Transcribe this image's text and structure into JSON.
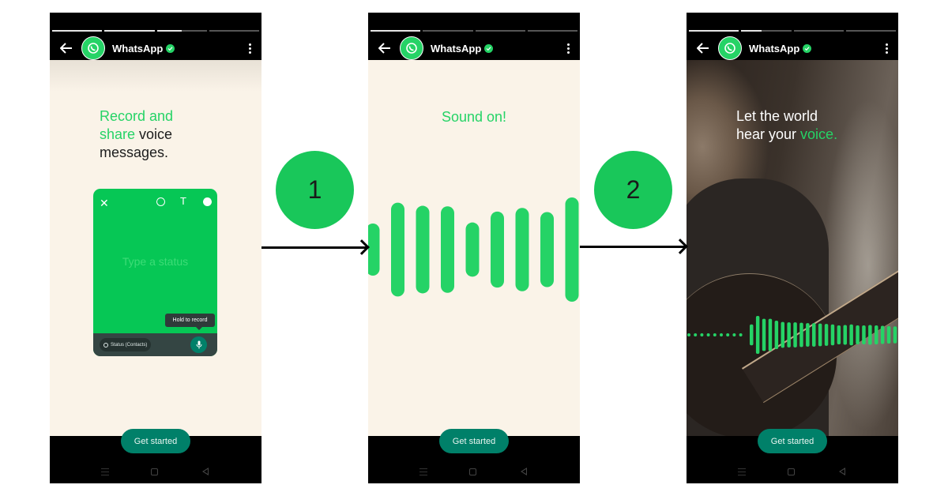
{
  "colors": {
    "brand_green": "#25d366",
    "teal_button": "#008069",
    "status_card_green": "#06c755",
    "cream_background": "#faf3e8",
    "step_badge": "#19c75a"
  },
  "screens": [
    {
      "header": {
        "title": "WhatsApp",
        "back_icon": "arrow-left-icon",
        "avatar_icon": "whatsapp-logo-icon",
        "verified_icon": "verified-check-icon",
        "menu_icon": "more-vertical-icon"
      },
      "progress": [
        1,
        1,
        0.5,
        0
      ],
      "headline": {
        "green": "Record and\nshare",
        "rest": " voice\nmessages."
      },
      "status_card": {
        "placeholder": "Type a status",
        "tooltip": "Hold to record",
        "audience": "Status (Contacts)",
        "icons": [
          "close-icon",
          "emoji-icon",
          "text-icon",
          "palette-icon",
          "mic-icon"
        ]
      },
      "cta": "Get started"
    },
    {
      "header": {
        "title": "WhatsApp"
      },
      "progress": [
        1,
        0,
        0,
        0
      ],
      "headline": "Sound on!",
      "waveform_levels": [
        0.5,
        0.9,
        0.84,
        0.83,
        0.52,
        0.73,
        0.8,
        0.72,
        1.0
      ],
      "cta": "Get started"
    },
    {
      "header": {
        "title": "WhatsApp"
      },
      "progress": [
        1,
        0.4,
        0,
        0
      ],
      "headline": {
        "white": "Let the world\nhear your ",
        "green": "voice."
      },
      "waveform_dots": 9,
      "waveform_levels": [
        0.55,
        1.0,
        0.85,
        0.85,
        0.75,
        0.68,
        0.66,
        0.66,
        0.64,
        0.62,
        0.62,
        0.6,
        0.58,
        0.55,
        0.5,
        0.52,
        0.55,
        0.5,
        0.5,
        0.52,
        0.5,
        0.48,
        0.46,
        0.45,
        0.4
      ],
      "cta": "Get started"
    }
  ],
  "steps": [
    {
      "label": "1"
    },
    {
      "label": "2"
    }
  ]
}
